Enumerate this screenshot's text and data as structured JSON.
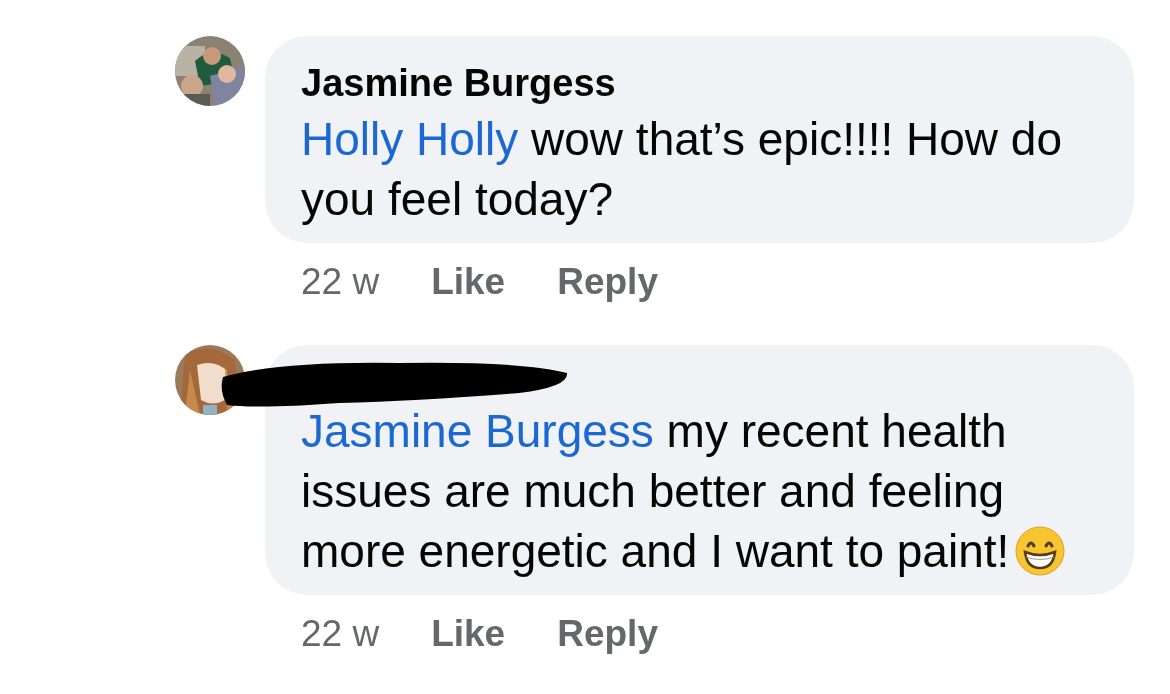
{
  "comments": [
    {
      "author": "Jasmine Burgess",
      "mention": "Holly Holly",
      "text": "wow that’s epic!!!! How do you feel today?",
      "emoji": false,
      "time": "22 w",
      "actions": [
        "Like",
        "Reply"
      ]
    },
    {
      "name_redacted": true,
      "mention": "Jasmine Burgess",
      "text": "my recent health issues are much better and feeling more energetic and I want to paint!",
      "emoji": true,
      "time": "22 w",
      "actions": [
        "Like",
        "Reply"
      ]
    }
  ]
}
